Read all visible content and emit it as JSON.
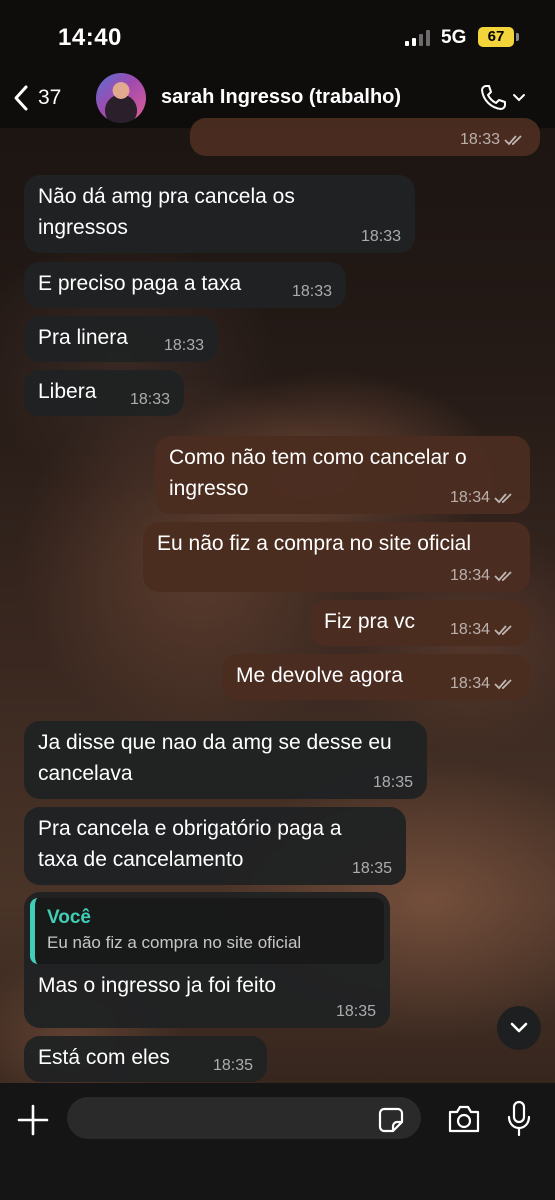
{
  "status_bar": {
    "time": "14:40",
    "network": "5G",
    "battery": "67"
  },
  "header": {
    "back_count": "37",
    "contact_name": "sarah Ingresso (trabalho)"
  },
  "messages": [
    {
      "direction": "out",
      "text": "",
      "time": "18:33",
      "read": true
    },
    {
      "direction": "in",
      "text": "Não dá amg pra cancela os ingressos",
      "time": "18:33"
    },
    {
      "direction": "in",
      "text": "E preciso paga a taxa",
      "time": "18:33"
    },
    {
      "direction": "in",
      "text": "Pra linera",
      "time": "18:33"
    },
    {
      "direction": "in",
      "text": "Libera",
      "time": "18:33"
    },
    {
      "direction": "out",
      "text": "Como não tem como cancelar o ingresso",
      "time": "18:34",
      "read": true
    },
    {
      "direction": "out",
      "text": "Eu não fiz a compra no site oficial",
      "time": "18:34",
      "read": true
    },
    {
      "direction": "out",
      "text": "Fiz pra vc",
      "time": "18:34",
      "read": true
    },
    {
      "direction": "out",
      "text": "Me devolve agora",
      "time": "18:34",
      "read": true
    },
    {
      "direction": "in",
      "text": "Ja disse que nao da amg se desse eu cancelava",
      "time": "18:35"
    },
    {
      "direction": "in",
      "text": "Pra cancela e obrigatório paga a taxa de cancelamento",
      "time": "18:35"
    },
    {
      "direction": "in",
      "text": "Mas o ingresso ja foi feito",
      "time": "18:35",
      "quote": {
        "author": "Você",
        "text": "Eu não fiz a compra no site oficial"
      }
    },
    {
      "direction": "in",
      "text": "Está com eles",
      "time": "18:35"
    }
  ],
  "colors": {
    "incoming_bubble": "#202223",
    "outgoing_bubble": "#4b2d20",
    "quote_accent": "#3fcfb6",
    "battery": "#f3d43a"
  },
  "icons": [
    "back-chevron-icon",
    "phone-icon",
    "chevron-down-icon",
    "read-receipt-icon",
    "plus-icon",
    "sticker-icon",
    "camera-icon",
    "microphone-icon"
  ]
}
